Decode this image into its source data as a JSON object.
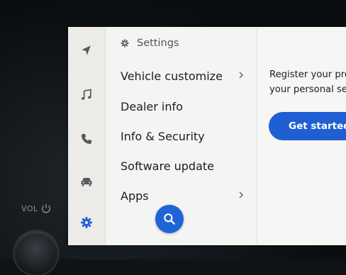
{
  "rail": {
    "items": [
      {
        "icon": "navigation-icon",
        "active": false
      },
      {
        "icon": "music-icon",
        "active": false
      },
      {
        "icon": "phone-icon",
        "active": false
      },
      {
        "icon": "car-icon",
        "active": false
      },
      {
        "icon": "gear-icon",
        "active": true
      }
    ]
  },
  "menu": {
    "header": {
      "icon": "gear-icon",
      "title": "Settings"
    },
    "items": [
      {
        "label": "Vehicle customize",
        "has_chevron": true
      },
      {
        "label": "Dealer info",
        "has_chevron": false
      },
      {
        "label": "Info & Security",
        "has_chevron": false
      },
      {
        "label": "Software update",
        "has_chevron": false
      },
      {
        "label": "Apps",
        "has_chevron": true
      }
    ],
    "search_icon": "search-icon"
  },
  "content": {
    "promo_line1": "Register your pro",
    "promo_line2": "your personal se",
    "button_label": "Get started"
  },
  "hardware": {
    "vol_label": "VOL",
    "power_icon": "power-icon"
  },
  "colors": {
    "accent": "#1f64d6",
    "active_icon": "#1c63d6",
    "inactive_icon": "#55585c",
    "screen_bg": "#f1f1ef"
  }
}
